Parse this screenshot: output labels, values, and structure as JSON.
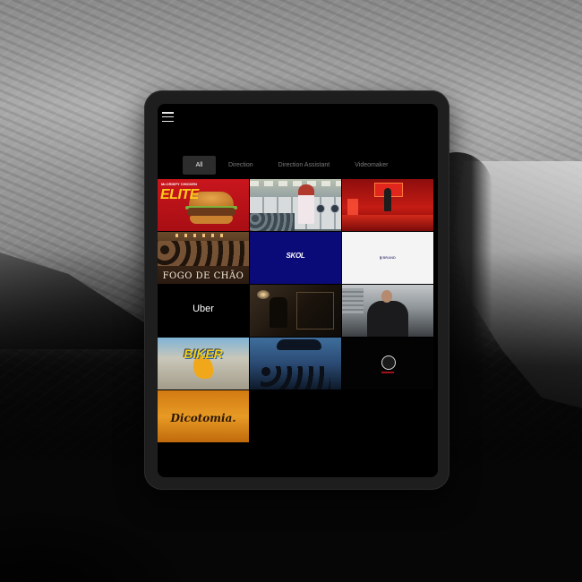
{
  "menu": {
    "icon": "hamburger-menu-icon"
  },
  "filters": [
    {
      "label": "All",
      "active": true
    },
    {
      "label": "Direction",
      "active": false
    },
    {
      "label": "Direction Assistant",
      "active": false
    },
    {
      "label": "Videomaker",
      "active": false
    }
  ],
  "tiles": {
    "burger": {
      "small": "Mr.CRISPY CHICKEN",
      "big": "ELITE"
    },
    "fogo": {
      "caption": "FOGO DE CHÃO"
    },
    "skol": {
      "caption": "SKOL",
      "sub": "· · · · ·"
    },
    "white": {
      "caption": "▮ BRAND"
    },
    "uber": {
      "caption": "Uber"
    },
    "graffiti": {
      "caption": "BIKER"
    },
    "dico": {
      "caption": "Dicotomia."
    }
  }
}
